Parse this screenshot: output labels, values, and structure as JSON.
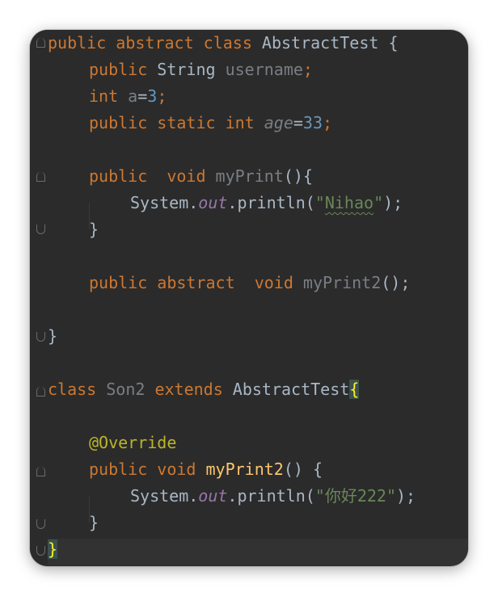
{
  "editor": {
    "lines": [
      {
        "tokens": [
          {
            "t": "public abstract class ",
            "c": "kw"
          },
          {
            "t": "AbstractTest {",
            "c": "id"
          }
        ]
      },
      {
        "tokens": [
          {
            "t": "public ",
            "c": "kw"
          },
          {
            "t": "String ",
            "c": "id"
          },
          {
            "t": "username",
            "c": "fld"
          },
          {
            "t": ";",
            "c": "kw"
          }
        ]
      },
      {
        "tokens": [
          {
            "t": "int ",
            "c": "kw"
          },
          {
            "t": "a",
            "c": "fld"
          },
          {
            "t": "=",
            "c": "id"
          },
          {
            "t": "3",
            "c": "num"
          },
          {
            "t": ";",
            "c": "kw"
          }
        ]
      },
      {
        "tokens": [
          {
            "t": "public static int ",
            "c": "kw"
          },
          {
            "t": "age",
            "c": "fld ital"
          },
          {
            "t": "=",
            "c": "id"
          },
          {
            "t": "33",
            "c": "num"
          },
          {
            "t": ";",
            "c": "kw"
          }
        ]
      },
      {
        "tokens": []
      },
      {
        "tokens": [
          {
            "t": "public  void ",
            "c": "kw"
          },
          {
            "t": "myPrint",
            "c": "dim"
          },
          {
            "t": "(){",
            "c": "id"
          }
        ]
      },
      {
        "tokens": [
          {
            "t": "System.",
            "c": "id"
          },
          {
            "t": "out",
            "c": "static"
          },
          {
            "t": ".println(",
            "c": "id"
          },
          {
            "t": "\"",
            "c": "str"
          },
          {
            "t": "Nihao",
            "c": "str sq"
          },
          {
            "t": "\"",
            "c": "str"
          },
          {
            "t": ");",
            "c": "id"
          }
        ]
      },
      {
        "tokens": [
          {
            "t": "}",
            "c": "id"
          }
        ]
      },
      {
        "tokens": []
      },
      {
        "tokens": [
          {
            "t": "public abstract  void ",
            "c": "kw"
          },
          {
            "t": "myPrint2",
            "c": "dim"
          },
          {
            "t": "();",
            "c": "id"
          }
        ]
      },
      {
        "tokens": []
      },
      {
        "tokens": [
          {
            "t": "}",
            "c": "id"
          }
        ]
      },
      {
        "tokens": []
      },
      {
        "tokens": [
          {
            "t": "class ",
            "c": "kw"
          },
          {
            "t": "Son2 ",
            "c": "dim"
          },
          {
            "t": "extends ",
            "c": "kw"
          },
          {
            "t": "AbstractTest",
            "c": "id"
          },
          {
            "t": "{",
            "c": "brace-hl"
          }
        ]
      },
      {
        "tokens": []
      },
      {
        "tokens": [
          {
            "t": "@Override",
            "c": "anno"
          }
        ]
      },
      {
        "tokens": [
          {
            "t": "public void ",
            "c": "kw"
          },
          {
            "t": "myPrint2",
            "c": "fn"
          },
          {
            "t": "() {",
            "c": "id"
          }
        ]
      },
      {
        "tokens": [
          {
            "t": "System.",
            "c": "id"
          },
          {
            "t": "out",
            "c": "static"
          },
          {
            "t": ".println(",
            "c": "id"
          },
          {
            "t": "\"你好222\"",
            "c": "str"
          },
          {
            "t": ");",
            "c": "id"
          }
        ]
      },
      {
        "tokens": [
          {
            "t": "}",
            "c": "id"
          }
        ]
      },
      {
        "tokens": [
          {
            "t": "}",
            "c": "brace-hl"
          }
        ]
      }
    ]
  }
}
